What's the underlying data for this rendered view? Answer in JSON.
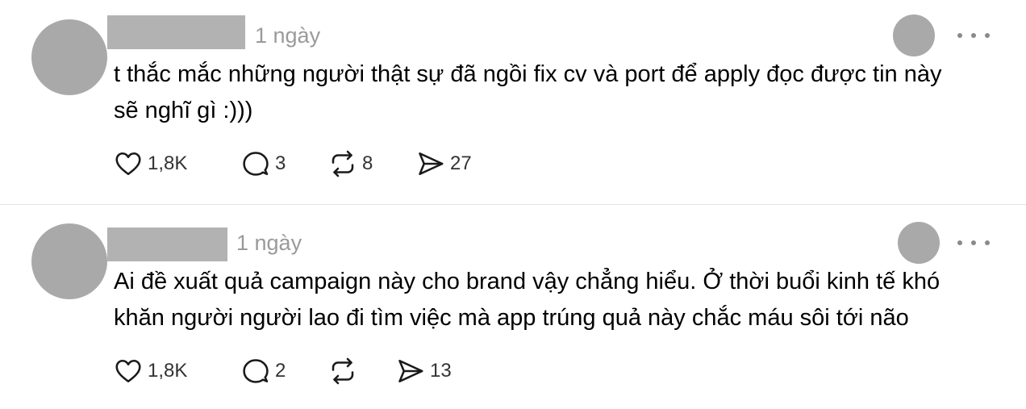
{
  "posts": [
    {
      "timestamp": "1 ngày",
      "text": "t thắc mắc những người thật sự đã ngồi fix cv và port để apply đọc được tin này\nsẽ nghĩ gì :)))",
      "likes": "1,8K",
      "replies": "3",
      "reposts": "8",
      "shares": "27"
    },
    {
      "timestamp": "1 ngày",
      "text": "Ai đề xuất quả campaign này cho brand vậy chẳng hiểu. Ở thời buổi kinh tế khó\nkhăn người người lao đi tìm việc mà app trúng quả này chắc máu sôi tới não",
      "likes": "1,8K",
      "replies": "2",
      "reposts": "",
      "shares": "13"
    }
  ],
  "icons": {
    "like": "heart-icon",
    "reply": "comment-icon",
    "repost": "repost-icon",
    "share": "share-icon",
    "more": "more-dots-icon"
  },
  "colors": {
    "text": "#000000",
    "muted": "#9a9a9a",
    "placeholder": "#a9a9a9",
    "divider": "#e3e3e3"
  }
}
